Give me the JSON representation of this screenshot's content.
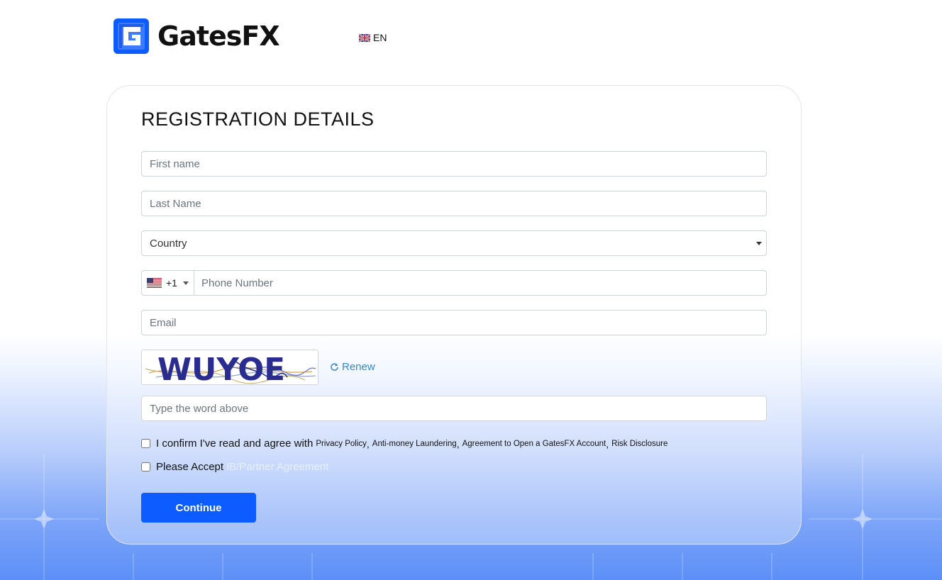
{
  "header": {
    "brand_name": "GatesFX",
    "language_label": "EN",
    "language_flag_icon": "uk-flag-icon"
  },
  "form": {
    "title": "REGISTRATION DETAILS",
    "first_name_placeholder": "First name",
    "last_name_placeholder": "Last Name",
    "country_label": "Country",
    "phone": {
      "country_flag_icon": "us-flag-icon",
      "dial_code": "+1",
      "placeholder": "Phone Number"
    },
    "email_placeholder": "Email",
    "captcha": {
      "text": "WUYOE",
      "renew_label": "Renew",
      "renew_icon": "refresh-icon",
      "input_placeholder": "Type the word above"
    },
    "agreement": {
      "prefix": "I confirm I've read and agree with",
      "links": [
        "Privacy Policy",
        "Anti-money Laundering",
        "Agreement to Open a GatesFX Account",
        "Risk Disclosure"
      ]
    },
    "partner": {
      "prefix": "Please Accept",
      "link": "IB/Partner Agreement"
    },
    "continue_label": "Continue"
  },
  "colors": {
    "brand_blue": "#0d5cff",
    "link_blue": "#3b86c8",
    "captcha_text": "#2a2d8f"
  }
}
